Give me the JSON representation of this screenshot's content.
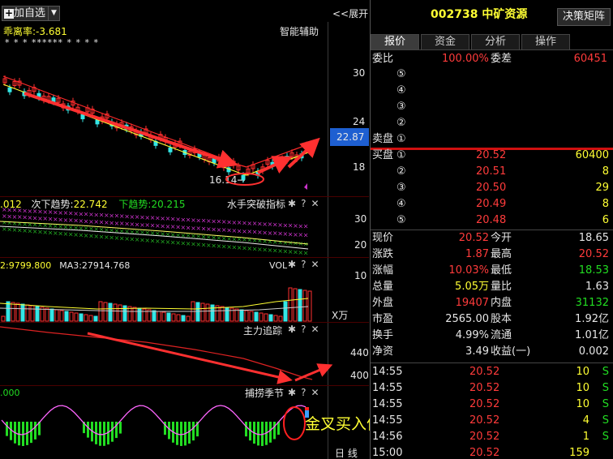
{
  "toolbar": {
    "add_label": "加自选",
    "expand_label": "展开"
  },
  "kline": {
    "deviation_label": "乖离率:",
    "deviation_value": "-3.681",
    "assist_label": "智能辅助",
    "stars": "* *    *    ****** * *    * *",
    "y_ticks": [
      "30",
      "24",
      "18"
    ],
    "current_price": "22.87",
    "low_label": "16.14"
  },
  "breakout": {
    "val0": ".012",
    "trend_label": "次下趋势:",
    "trend_value": "22.742",
    "down_label": "下趋势:",
    "down_value": "20.215",
    "title": "水手突破指标",
    "y_ticks": [
      "30",
      "20"
    ]
  },
  "volume": {
    "ma2": "2:9799.800",
    "ma3": "MA3:27914.768",
    "title": "VOL",
    "y_ticks": [
      "10"
    ],
    "unit": "X万"
  },
  "mainforce": {
    "title": "主力追踪",
    "y_ticks": [
      "440",
      "400"
    ]
  },
  "capture": {
    "value": ".000",
    "title": "捕捞季节",
    "annotation": "金叉买入信号",
    "footer": "日  线"
  },
  "quote": {
    "code": "002738",
    "name": "中矿资源",
    "matrix_button": "决策矩阵",
    "tabs": [
      "报价",
      "资金",
      "分析",
      "操作"
    ],
    "ratio_label": "委比",
    "ratio_value": "100.00%",
    "diff_label": "委差",
    "diff_value": "60451",
    "sell_label": "卖盘",
    "buy_label": "买盘",
    "sells": [
      {
        "level": "⑤",
        "price": "",
        "vol": ""
      },
      {
        "level": "④",
        "price": "",
        "vol": ""
      },
      {
        "level": "③",
        "price": "",
        "vol": ""
      },
      {
        "level": "②",
        "price": "",
        "vol": ""
      },
      {
        "level": "①",
        "price": "",
        "vol": ""
      }
    ],
    "buys": [
      {
        "level": "①",
        "price": "20.52",
        "vol": "60400"
      },
      {
        "level": "②",
        "price": "20.51",
        "vol": "8"
      },
      {
        "level": "③",
        "price": "20.50",
        "vol": "29"
      },
      {
        "level": "④",
        "price": "20.49",
        "vol": "8"
      },
      {
        "level": "⑤",
        "price": "20.48",
        "vol": "6"
      }
    ],
    "stats": [
      {
        "l1": "现价",
        "v1": "20.52",
        "c1": "r",
        "l2": "今开",
        "v2": "18.65",
        "c2": "w"
      },
      {
        "l1": "涨跌",
        "v1": "1.87",
        "c1": "r",
        "l2": "最高",
        "v2": "20.52",
        "c2": "r"
      },
      {
        "l1": "涨幅",
        "v1": "10.03%",
        "c1": "r",
        "l2": "最低",
        "v2": "18.53",
        "c2": "g"
      },
      {
        "l1": "总量",
        "v1": "5.05万",
        "c1": "y",
        "l2": "量比",
        "v2": "1.63",
        "c2": "w"
      },
      {
        "l1": "外盘",
        "v1": "19407",
        "c1": "r",
        "l2": "内盘",
        "v2": "31132",
        "c2": "g"
      },
      {
        "l1": "市盈",
        "v1": "2565.00",
        "c1": "w",
        "l2": "股本",
        "v2": "1.92亿",
        "c2": "w"
      },
      {
        "l1": "换手",
        "v1": "4.99%",
        "c1": "w",
        "l2": "流通",
        "v2": "1.01亿",
        "c2": "w"
      },
      {
        "l1": "净资",
        "v1": "3.49",
        "c1": "w",
        "l2": "收益(一)",
        "v2": "0.002",
        "c2": "w"
      }
    ],
    "ticks": [
      {
        "time": "14:55",
        "price": "20.52",
        "vol": "10",
        "dir": "S"
      },
      {
        "time": "14:55",
        "price": "20.52",
        "vol": "10",
        "dir": "S"
      },
      {
        "time": "14:55",
        "price": "20.52",
        "vol": "10",
        "dir": "S"
      },
      {
        "time": "14:55",
        "price": "20.52",
        "vol": "4",
        "dir": "S"
      },
      {
        "time": "14:56",
        "price": "20.52",
        "vol": "1",
        "dir": "S"
      },
      {
        "time": "15:00",
        "price": "20.52",
        "vol": "159",
        "dir": ""
      }
    ]
  }
}
